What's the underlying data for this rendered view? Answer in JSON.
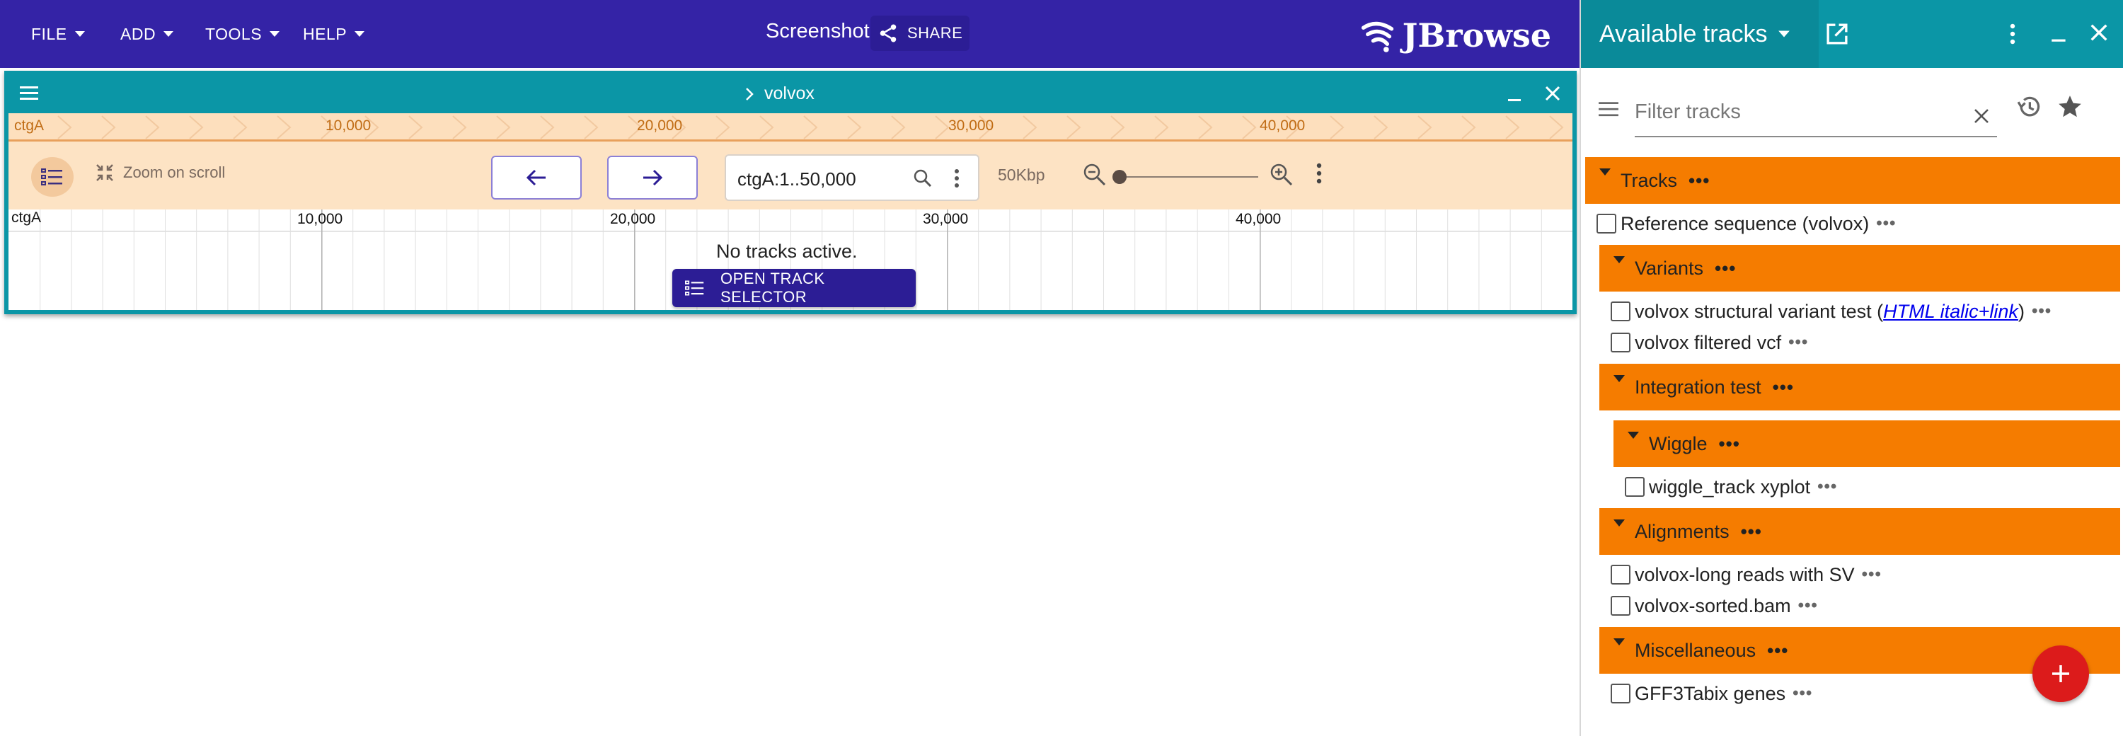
{
  "appbar": {
    "menus": [
      "FILE",
      "ADD",
      "TOOLS",
      "HELP"
    ],
    "title": "Screenshot",
    "share_label": "SHARE",
    "logo_text": "JBrowse"
  },
  "view": {
    "name": "volvox",
    "overview": {
      "refname": "ctgA",
      "tick_labels": [
        "10,000",
        "20,000",
        "30,000",
        "40,000"
      ]
    },
    "controls": {
      "zoom_on_scroll": "Zoom on scroll",
      "location": "ctgA:1..50,000",
      "bp_width": "50Kbp",
      "zoom_level": 0.0
    },
    "ruler": {
      "refname": "ctgA",
      "tick_labels": [
        "10,000",
        "20,000",
        "30,000",
        "40,000"
      ]
    },
    "no_tracks_text": "No tracks active.",
    "open_track_selector_label": "OPEN TRACK SELECTOR"
  },
  "drawer": {
    "widget_title": "Available tracks",
    "filter_placeholder": "Filter tracks",
    "categories": {
      "tracks": "Tracks",
      "variants": "Variants",
      "integration": "Integration test",
      "wiggle": "Wiggle",
      "alignments": "Alignments",
      "misc": "Miscellaneous"
    },
    "tracks": {
      "refseq": "Reference sequence (volvox)",
      "sv_prefix": "volvox structural variant test (",
      "sv_link": "HTML italic+link",
      "sv_suffix": ")",
      "filtered_vcf": "volvox filtered vcf",
      "wiggle_xyplot": "wiggle_track xyplot",
      "long_reads": "volvox-long reads with SV",
      "sorted_bam": "volvox-sorted.bam",
      "gff3tabix": "GFF3Tabix genes"
    },
    "dots": "•••"
  },
  "colors": {
    "appbar": "#3423a6",
    "view_header": "#0b96a6",
    "category": "#f57c00",
    "overview": "#fddfbd",
    "fab": "#dc1b1b"
  }
}
